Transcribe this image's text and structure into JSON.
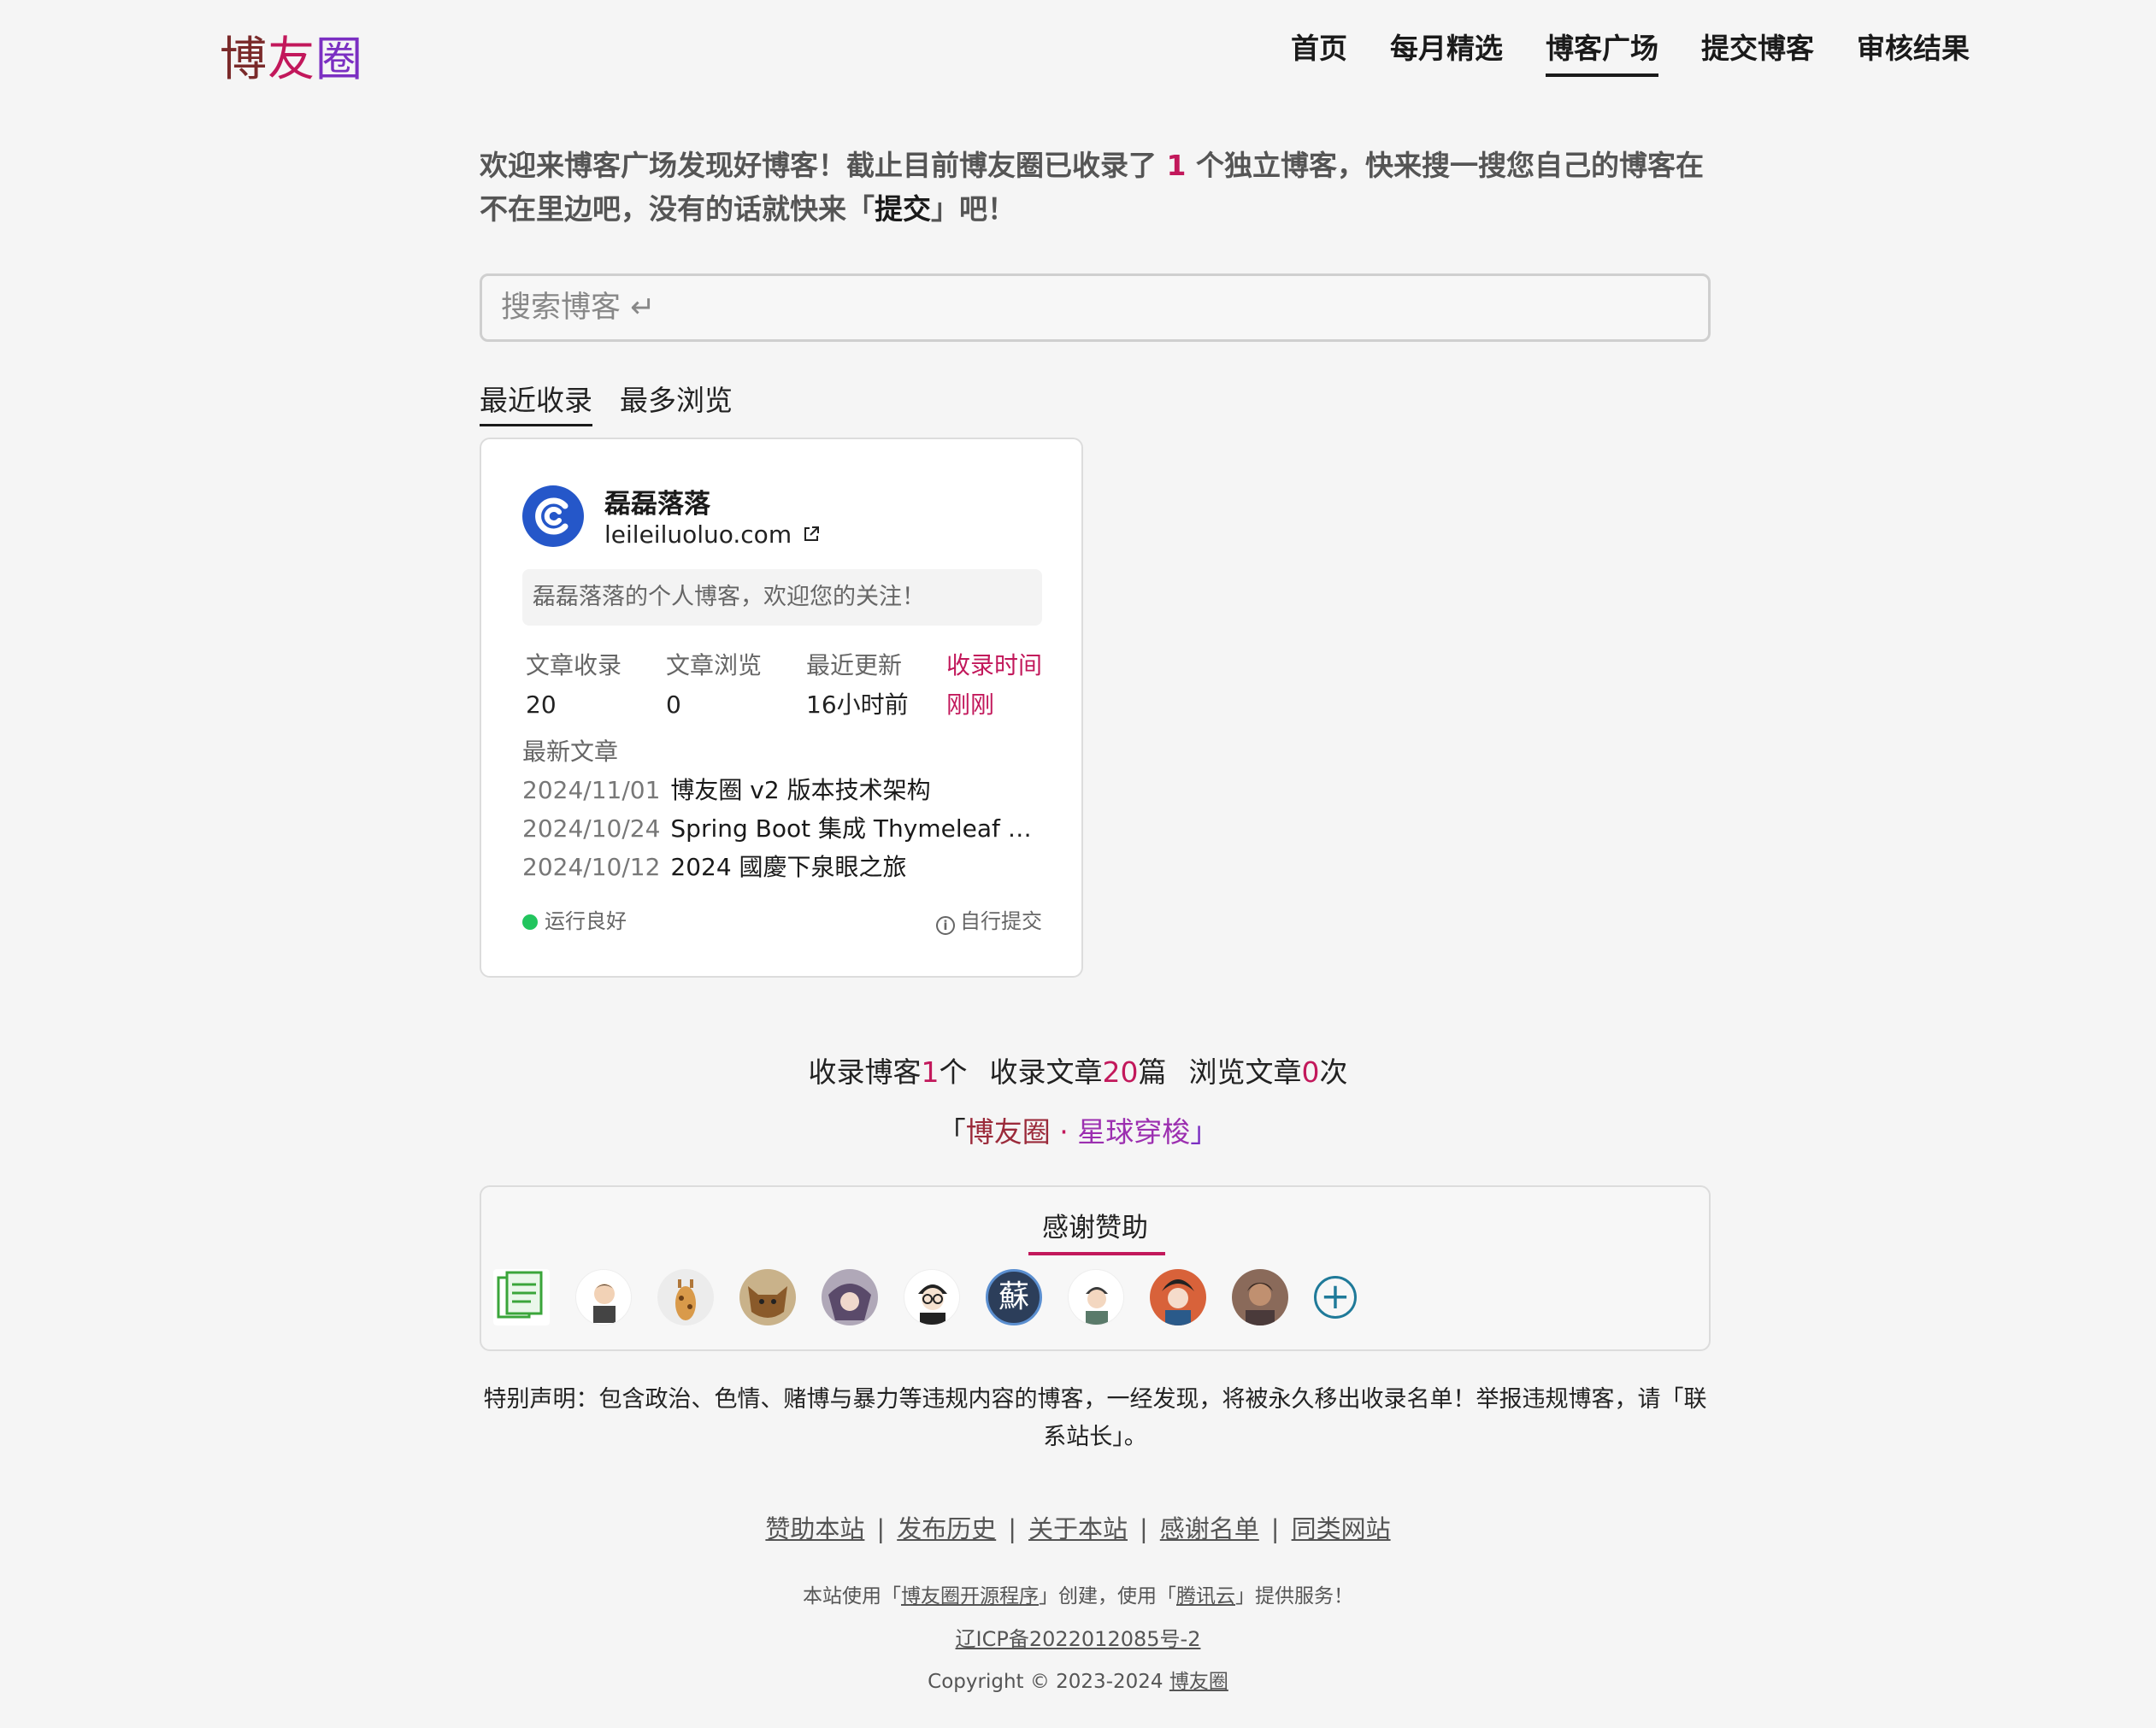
{
  "logo": {
    "char1": "博",
    "char2": "友",
    "char3": "圈",
    "colors": [
      "#7a2a2a",
      "#c2185b",
      "#7b2fc2"
    ]
  },
  "nav": [
    {
      "label": "首页",
      "active": false
    },
    {
      "label": "每月精选",
      "active": false
    },
    {
      "label": "博客广场",
      "active": true
    },
    {
      "label": "提交博客",
      "active": false
    },
    {
      "label": "审核结果",
      "active": false
    }
  ],
  "intro": {
    "part1": "欢迎来博客广场发现好博客！截止目前博友圈已收录了 ",
    "count": "1",
    "part2": " 个独立博客，快来搜一搜您自己的博客在不在里边吧，没有的话就快来「",
    "submit": "提交",
    "part3": "」吧！"
  },
  "search": {
    "placeholder": "搜索博客 ↵"
  },
  "tabs": [
    {
      "label": "最近收录",
      "active": true
    },
    {
      "label": "最多浏览",
      "active": false
    }
  ],
  "card": {
    "name": "磊磊落落",
    "url": "leileiluoluo.com",
    "desc": "磊磊落落的个人博客，欢迎您的关注！",
    "stats": [
      {
        "label": "文章收录",
        "value": "20"
      },
      {
        "label": "文章浏览",
        "value": "0"
      },
      {
        "label": "最近更新",
        "value": "16小时前"
      },
      {
        "label": "收录时间",
        "value": "刚刚"
      }
    ],
    "latest_label": "最新文章",
    "articles": [
      {
        "date": "2024/11/01",
        "title": "博友圈 v2 版本技术架构"
      },
      {
        "date": "2024/10/24",
        "title": "Spring Boot 集成 Thymeleaf 搭建..."
      },
      {
        "date": "2024/10/12",
        "title": "2024 國慶下泉眼之旅"
      }
    ],
    "status": "运行良好",
    "source": "自行提交",
    "status_color": "#22c55e"
  },
  "summary": {
    "blogs_prefix": "收录博客",
    "blogs": "1",
    "blogs_suffix": "个",
    "articles_prefix": "收录文章",
    "articles": "20",
    "articles_suffix": "篇",
    "views_prefix": "浏览文章",
    "views": "0",
    "views_suffix": "次"
  },
  "slogan": {
    "open": "「",
    "name": "博友圈",
    "dot": " · ",
    "tagline": "星球穿梭",
    "close": "」"
  },
  "sponsors": {
    "title": "感谢赞助",
    "count": 10
  },
  "statement": "特别声明：包含政治、色情、赌博与暴力等违规内容的博客，一经发现，将被永久移出收录名单！举报违规博客，请「联系站长」。",
  "footer": {
    "links": [
      "赞助本站",
      "发布历史",
      "关于本站",
      "感谢名单",
      "同类网站"
    ],
    "powered_1": "本站使用「",
    "powered_link1": "博友圈开源程序",
    "powered_2": "」创建，使用「",
    "powered_link2": "腾讯云",
    "powered_3": "」提供服务！",
    "icp": "辽ICP备2022012085号-2",
    "copyright_prefix": "Copyright © 2023-2024 ",
    "copyright_link": "博友圈"
  },
  "accent_color": "#c2185b"
}
